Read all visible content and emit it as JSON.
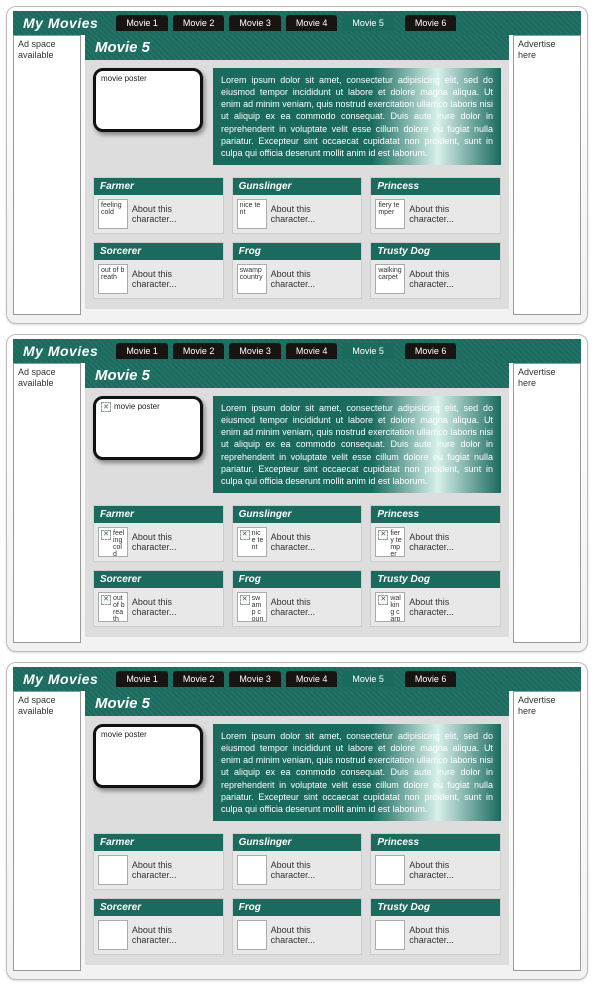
{
  "site_title": "My Movies",
  "tabs": [
    "Movie 1",
    "Movie 2",
    "Movie 3",
    "Movie 4",
    "Movie 5",
    "Movie 6"
  ],
  "active_tab_index": 4,
  "left_ad": "Ad space available",
  "right_ad": "Advertise here",
  "page_heading": "Movie 5",
  "poster_alt": "movie poster",
  "description": "Lorem ipsum dolor sit amet, consectetur adipisicing elit, sed do eiusmod tempor incididunt ut labore et dolore magna aliqua. Ut enim ad minim veniam, quis nostrud exercitation ullamco laboris nisi ut aliquip ex ea commodo consequat. Duis aute irure dolor in reprehenderit in voluptate velit esse cillum dolore eu fugiat nulla pariatur. Excepteur sint occaecat cupidatat non proident, sunt in culpa qui officia deserunt mollit anim id est laborum.",
  "card_text": "About this character...",
  "characters": [
    {
      "name": "Farmer",
      "alt": "feeling cold"
    },
    {
      "name": "Gunslinger",
      "alt": "nice tent"
    },
    {
      "name": "Princess",
      "alt": "fiery temper"
    },
    {
      "name": "Sorcerer",
      "alt": "out of breath"
    },
    {
      "name": "Frog",
      "alt": "swamp country"
    },
    {
      "name": "Trusty Dog",
      "alt": "walking carpet"
    }
  ]
}
